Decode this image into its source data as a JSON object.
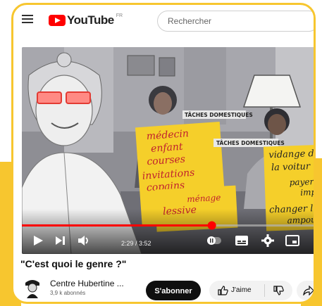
{
  "header": {
    "logo_text": "YouTube",
    "region_code": "FR",
    "search_placeholder": "Rechercher"
  },
  "video": {
    "time": "2:29 / 3:52",
    "progress": 0.642,
    "overlay": {
      "tag_1": "TÂCHES DOMESTIQUES",
      "tag_2": "TÂCHES DOMESTIQUES",
      "note_1": [
        "médecin",
        "enfant",
        "courses",
        "invitations",
        "copains",
        "ménage",
        "lessive"
      ],
      "note_2": [
        "vidange d",
        "la voitur",
        "payer",
        "imp",
        "changer le",
        "ampoule"
      ]
    }
  },
  "title": "\"C'est quoi le genre ?\"",
  "channel": {
    "name": "Centre Hubertine ...",
    "subscribers": "3,9 k abonnés"
  },
  "actions": {
    "subscribe_label": "S'abonner",
    "like_label": "J'aime"
  },
  "colors": {
    "accent_yellow": "#f7c62f",
    "progress_red": "#ff0000",
    "note_yellow": "#f5cf2a"
  }
}
